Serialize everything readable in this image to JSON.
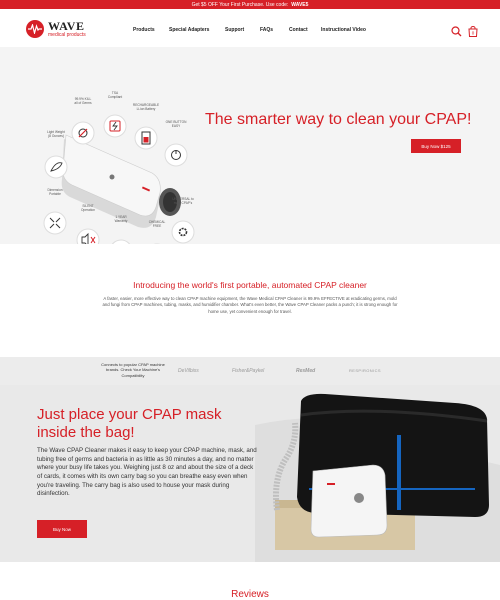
{
  "promo": {
    "text": "Get $5 OFF Your First Purchase. Use code:",
    "code": "WAVE5"
  },
  "header": {
    "logo_name": "WAVE",
    "logo_sub": "medical products",
    "nav": [
      "Products",
      "Special Adapters",
      "Support",
      "FAQs",
      "Contact",
      "Instructional Video"
    ],
    "icons": [
      "search-icon",
      "cart-icon"
    ]
  },
  "hero": {
    "title": "The smarter way to clean your CPAP!",
    "button": "Buy Now $125",
    "features": [
      "99.9% KILL\nall of Germs",
      "TSA\nCompliant",
      "RECHARGEABLE\nLi-ion Battery",
      "ONE BUTTON\nEASY",
      "Light Weight\n(8 Ounces)",
      "UNIVERSAL to\nmost CPAP's",
      "Dimension\nPortable",
      "SILENT\nOperation",
      "1 YEAR\nWarranty",
      "CHEMICAL\nFREE"
    ]
  },
  "intro": {
    "title": "Introducing the world's first portable, automated CPAP cleaner",
    "text": "A faster, easier, more effective way to clean CPAP machine equipment, the Wave Medical CPAP Cleaner is 99.9% EFFECTIVE at eradicating germs, mold and fungi from CPAP machines, tubing, masks, and humidifier chamber. What's even better, the Wave CPAP Cleaner packs a punch; it is strong enough for home use, yet convenient enough for travel."
  },
  "brands": {
    "note": "Connects to popular CPAP machine brands. Check Your Machine's Compatibility",
    "names": [
      "DeVilbiss",
      "Fisher&Paykel",
      "ResMed",
      "RESPIRONICS"
    ]
  },
  "bag_section": {
    "title": "Just place your CPAP mask inside the bag!",
    "text": "The Wave CPAP Cleaner makes it easy to keep your CPAP machine, mask, and tubing free of germs and bacteria in as little as 30 minutes a day, and no matter where your busy life takes you. Weighing just 8 oz and about the size of a deck of cards, it comes with its own carry bag so you can breathe easy even when you're traveling. The carry bag is also used to house your mask during disinfection.",
    "button": "Buy Now"
  },
  "reviews": {
    "title": "Reviews"
  },
  "colors": {
    "brand_red": "#d62027",
    "hero_bg": "#f4f4f4",
    "section_gray": "#e9e9e9"
  }
}
